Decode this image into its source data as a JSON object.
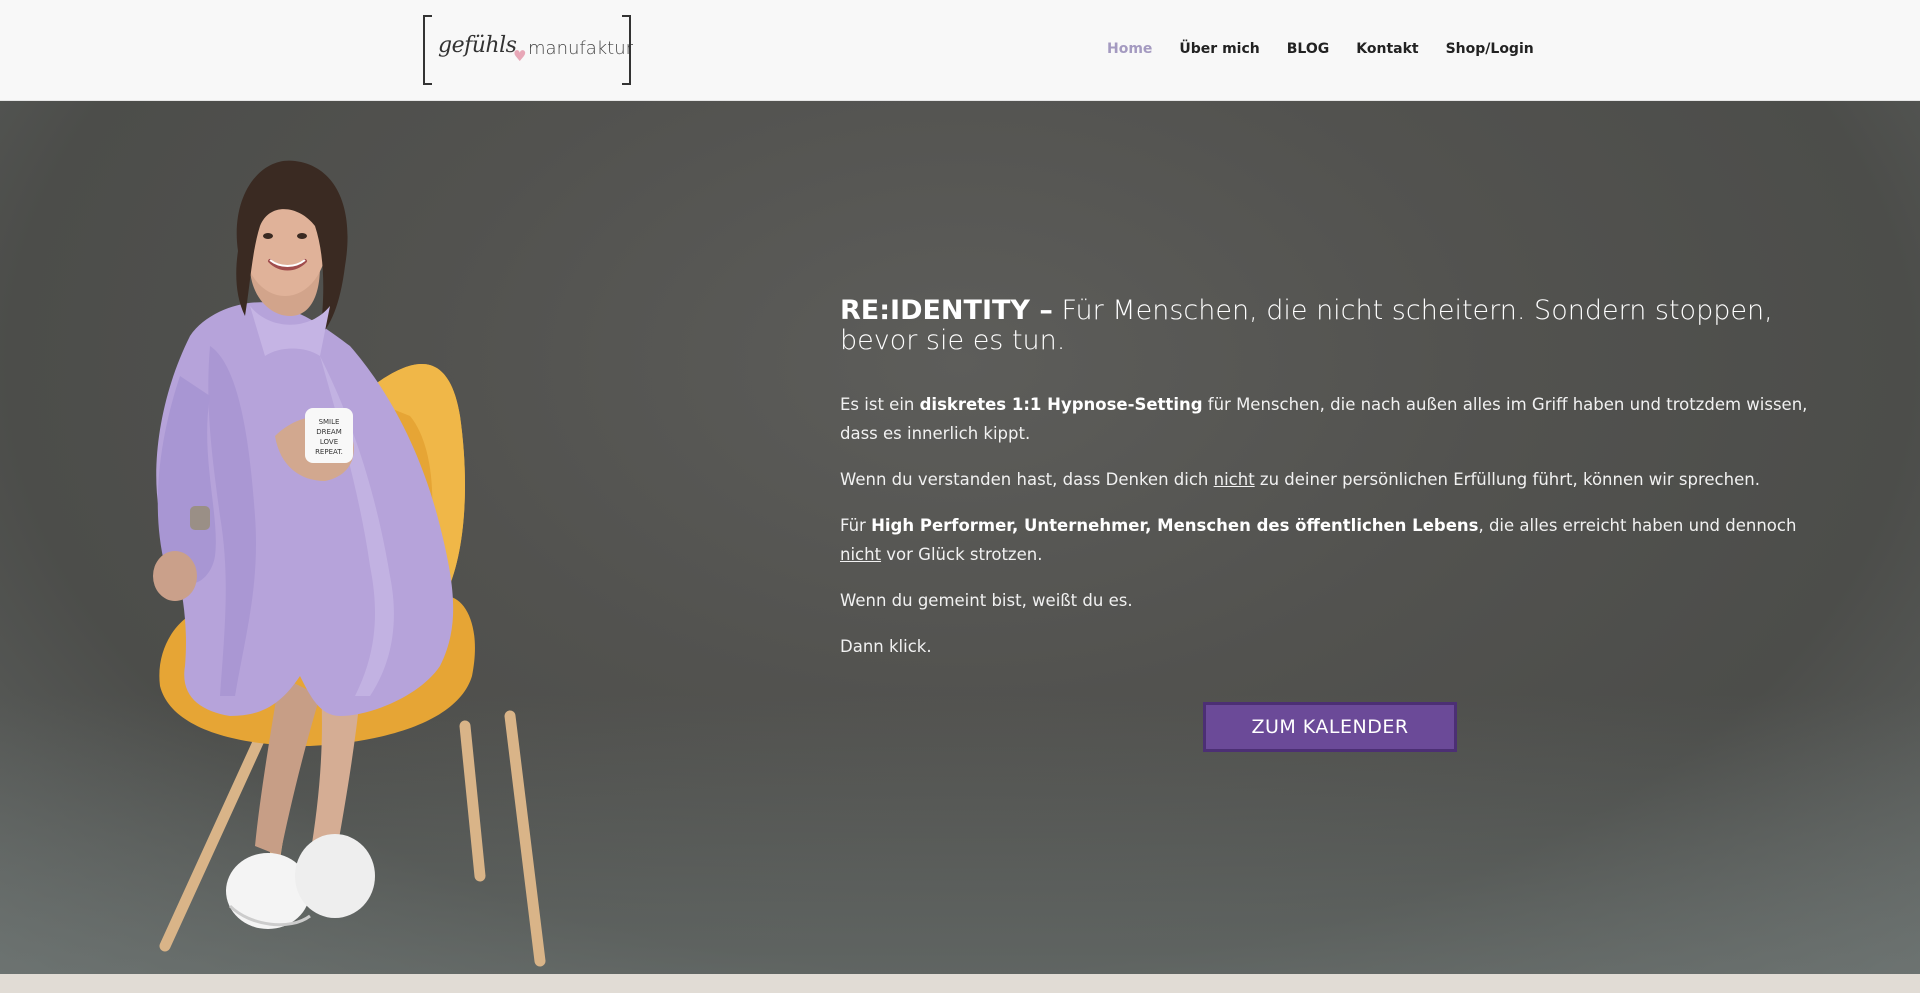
{
  "header": {
    "logo": {
      "script_text": "gefühls",
      "word_text": "manufaktur"
    },
    "nav": [
      {
        "label": "Home",
        "active": true
      },
      {
        "label": "Über mich",
        "active": false
      },
      {
        "label": "BLOG",
        "active": false
      },
      {
        "label": "Kontakt",
        "active": false
      },
      {
        "label": "Shop/Login",
        "active": false
      }
    ]
  },
  "hero": {
    "headline_strong": "RE:IDENTITY –",
    "headline_rest": " Für Menschen, die nicht scheitern. Sondern stoppen, bevor sie es tun.",
    "p1_a": "Es ist ein ",
    "p1_b": "diskretes 1:1 Hypnose-Setting",
    "p1_c": " für Menschen, die nach außen alles im Griff haben und trotzdem wissen, dass es innerlich kippt.",
    "p2_a": "Wenn du verstanden hast, dass Denken dich ",
    "p2_u": "nicht",
    "p2_c": " zu deiner persönlichen Erfüllung führt, können wir sprechen.",
    "p3_a": "Für ",
    "p3_b": "High Performer, Unternehmer, Menschen des öffentlichen Lebens",
    "p3_c": ", die alles erreicht haben und dennoch ",
    "p3_u": "nicht",
    "p3_d": " vor Glück strotzen.",
    "p4": "Wenn du gemeint bist, weißt du es.",
    "p5": "Dann klick.",
    "cta_label": "ZUM KALENDER",
    "mug_text": "SMILE DREAM LOVE REPEAT."
  },
  "colors": {
    "accent": "#6b4a98",
    "nav_active": "#a49ac0",
    "hero_bg": "#52524f"
  }
}
